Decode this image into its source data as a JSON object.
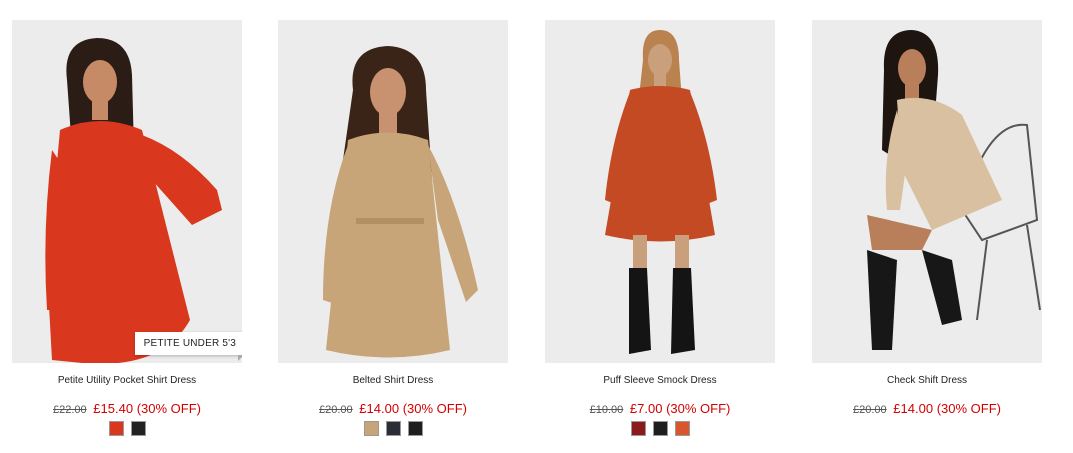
{
  "products": [
    {
      "name": "Petite Utility Pocket Shirt Dress",
      "was_price": "£22.00",
      "now_price": "£15.40",
      "discount": "(30% OFF)",
      "badge": "PETITE UNDER 5'3",
      "dress_color": "#d9381e",
      "swatches": [
        {
          "color": "#d9381e"
        },
        {
          "color": "#222222"
        }
      ]
    },
    {
      "name": "Belted Shirt Dress",
      "was_price": "£20.00",
      "now_price": "£14.00",
      "discount": "(30% OFF)",
      "dress_color": "#c8a479",
      "swatches": [
        {
          "color": "#c8a479"
        },
        {
          "color": "#2a2d35"
        },
        {
          "color": "#1e1e1e"
        }
      ]
    },
    {
      "name": "Puff Sleeve Smock Dress",
      "was_price": "£10.00",
      "now_price": "£7.00",
      "discount": "(30% OFF)",
      "dress_color": "#c44a24",
      "swatches": [
        {
          "color": "#8b1a1a"
        },
        {
          "color": "#1e1e1e"
        },
        {
          "color": "#d9552e"
        }
      ]
    },
    {
      "name": "Check Shift Dress",
      "was_price": "£20.00",
      "now_price": "£14.00",
      "discount": "(30% OFF)",
      "dress_color": "#d9c0a1",
      "swatches": []
    }
  ]
}
